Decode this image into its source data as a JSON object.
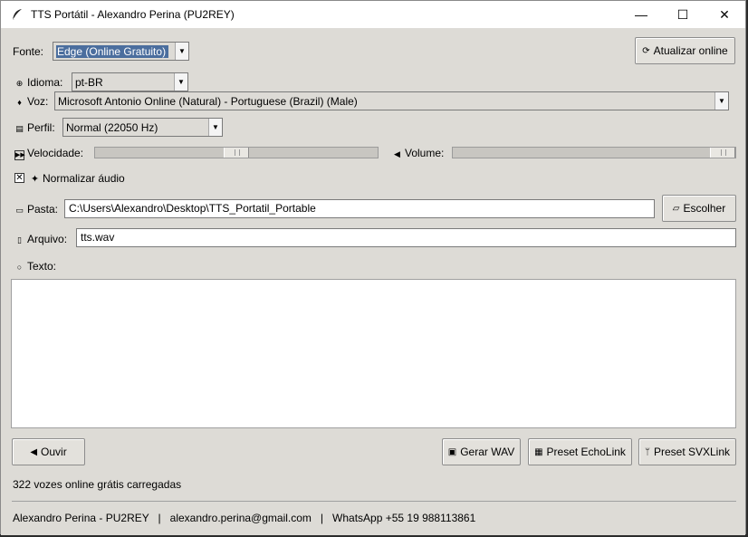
{
  "window": {
    "title": "TTS Portátil - Alexandro Perina (PU2REY)",
    "min_glyph": "—",
    "max_glyph": "☐",
    "close_glyph": "✕"
  },
  "fonte": {
    "label": "Fonte:",
    "value": "Edge (Online Gratuito)"
  },
  "refresh_button": {
    "label": "Atualizar online",
    "icon": "refresh-icon"
  },
  "idioma": {
    "icon": "globe-icon",
    "label": "Idioma:",
    "value": "pt-BR"
  },
  "voz": {
    "icon": "microphone-icon",
    "label": "Voz:",
    "value": "Microsoft Antonio Online (Natural) - Portuguese (Brazil) (Male)"
  },
  "perfil": {
    "icon": "sliders-icon",
    "label": "Perfil:",
    "value": "Normal (22050 Hz)"
  },
  "velocidade": {
    "icon": "fast-forward-icon",
    "label": "Velocidade:",
    "level_fraction": 0.5
  },
  "volume": {
    "icon": "speaker-icon",
    "label": "Volume:",
    "level_fraction": 1.0
  },
  "normalize": {
    "checked": true,
    "check_glyph": "✕",
    "icon": "sparkle-icon",
    "label": "Normalizar áudio"
  },
  "pasta": {
    "icon": "folder-icon",
    "label": "Pasta:",
    "value": "C:\\Users\\Alexandro\\Desktop\\TTS_Portatil_Portable",
    "button_label": "Escolher",
    "button_icon": "open-folder-icon"
  },
  "arquivo": {
    "icon": "file-icon",
    "label": "Arquivo:",
    "value": "tts.wav"
  },
  "texto": {
    "icon": "speech-bubble-icon",
    "label": "Texto:",
    "value": ""
  },
  "actions": {
    "ouvir": {
      "label": "Ouvir",
      "icon": "speaker-icon"
    },
    "gerar": {
      "label": "Gerar WAV",
      "icon": "save-icon"
    },
    "echolink": {
      "label": "Preset EchoLink",
      "icon": "radio-icon"
    },
    "svxlink": {
      "label": "Preset SVXLink",
      "icon": "antenna-icon"
    }
  },
  "status": "322 vozes online grátis carregadas",
  "footer": "Alexandro Perina - PU2REY   |   alexandro.perina@gmail.com   |   WhatsApp +55 19 988113861"
}
